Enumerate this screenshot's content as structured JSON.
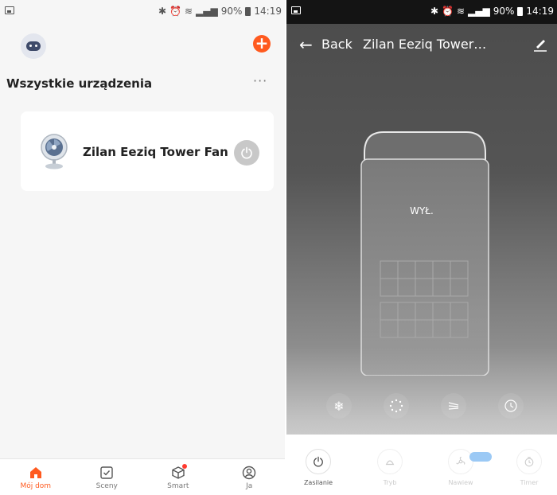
{
  "left": {
    "status_time": "14:19",
    "status_battery": "90%",
    "section_title": "Wszystkie urządzenia",
    "more_label": "···",
    "add_label": "+",
    "device": {
      "name": "Zilan Eeziq Tower Fan",
      "power_state": "off"
    },
    "tabs": [
      {
        "label": "Mój dom",
        "icon": "home-icon",
        "active": true
      },
      {
        "label": "Sceny",
        "icon": "checkbox-icon",
        "active": false
      },
      {
        "label": "Smart",
        "icon": "cube-icon",
        "active": false,
        "badge": true
      },
      {
        "label": "Ja",
        "icon": "user-icon",
        "active": false
      }
    ],
    "colors": {
      "accent": "#ff5a1f",
      "background": "#f6f6f6"
    }
  },
  "right": {
    "status_time": "14:19",
    "status_battery": "90%",
    "back_label": "Back",
    "device_title": "Zilan Eeziq Tower…",
    "status_text": "WYŁ.",
    "mode_icons": [
      "snowflake-icon",
      "dots-ring-icon",
      "wind-icon",
      "clock-icon"
    ],
    "controls": [
      {
        "label": "Zasilanie",
        "icon": "power-icon",
        "enabled": true
      },
      {
        "label": "Tryb",
        "icon": "mode-icon",
        "enabled": false
      },
      {
        "label": "Nawiew",
        "icon": "fan-speed-icon",
        "enabled": false
      },
      {
        "label": "Timer",
        "icon": "timer-icon",
        "enabled": false
      }
    ]
  }
}
